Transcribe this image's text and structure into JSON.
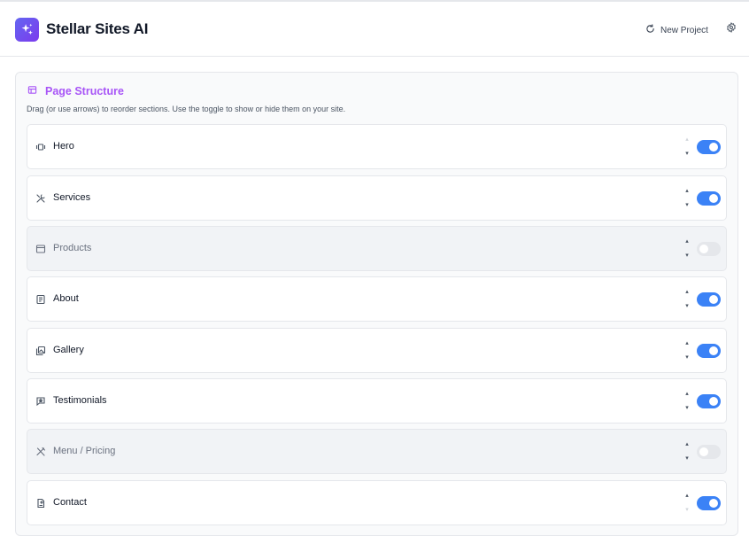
{
  "header": {
    "title": "Stellar Sites AI",
    "new_project_label": "New Project",
    "accent": "#6366f1"
  },
  "panel": {
    "title": "Page Structure",
    "description": "Drag (or use arrows) to reorder sections. Use the toggle to show or hide them on your site.",
    "title_color": "#a855f7"
  },
  "sections": [
    {
      "label": "Hero",
      "icon": "hero-icon",
      "enabled": true
    },
    {
      "label": "Services",
      "icon": "tools-icon",
      "enabled": true
    },
    {
      "label": "Products",
      "icon": "store-icon",
      "enabled": false
    },
    {
      "label": "About",
      "icon": "document-icon",
      "enabled": true
    },
    {
      "label": "Gallery",
      "icon": "gallery-icon",
      "enabled": true
    },
    {
      "label": "Testimonials",
      "icon": "message-star-icon",
      "enabled": true
    },
    {
      "label": "Menu / Pricing",
      "icon": "utensils-icon",
      "enabled": false
    },
    {
      "label": "Contact",
      "icon": "contact-file-icon",
      "enabled": true
    }
  ],
  "colors": {
    "toggle_on": "#3b82f6",
    "toggle_off": "#e5e7eb",
    "disabled_row_bg": "#f1f3f6"
  }
}
